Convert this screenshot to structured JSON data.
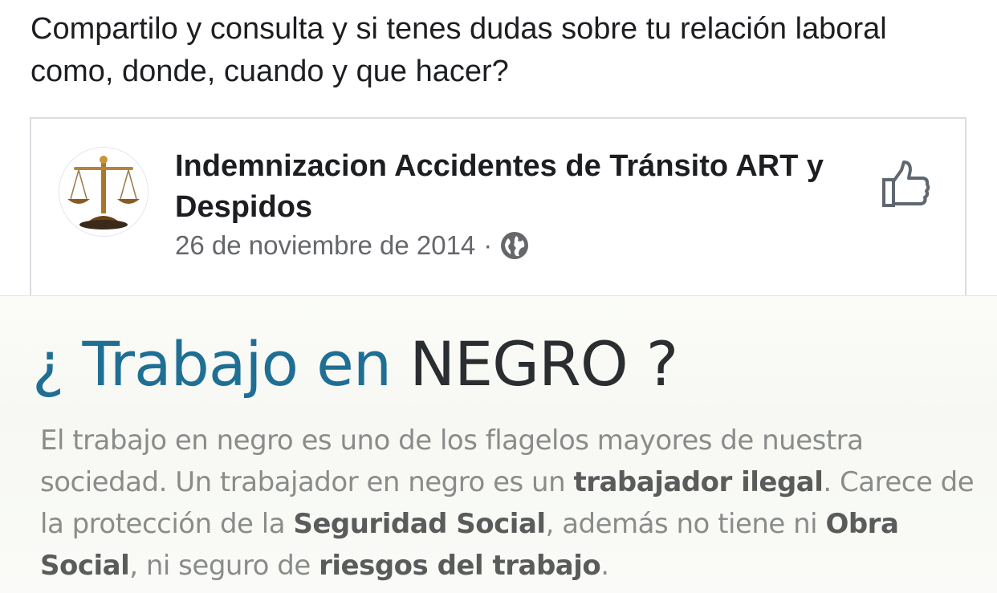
{
  "post": {
    "text": "Compartilo y consulta y si tenes dudas sobre tu relación laboral como, donde, cuando  y que hacer?"
  },
  "shared": {
    "page_name": "Indemnizacion Accidentes de Tránsito ART y Despidos",
    "date": "26 de noviembre de 2014",
    "separator": "·",
    "avatar_icon": "scales-of-justice-icon",
    "privacy_icon": "globe-icon",
    "like_icon": "thumbs-up-icon"
  },
  "image": {
    "headline_q_open": "¿",
    "headline_blue": "Trabajo en",
    "headline_dark": "NEGRO ?",
    "body": {
      "p1": "El trabajo en negro es uno de los flagelos mayores de nuestra sociedad. Un trabajador en negro es un ",
      "b1": "trabajador ilegal",
      "p2": ". Carece de la protección de la ",
      "b2": "Seguridad Social",
      "p3": ", además no tiene ni ",
      "b3": "Obra Social",
      "p4": ", ni seguro de ",
      "b4": "riesgos del trabajo",
      "p5": "."
    }
  },
  "colors": {
    "text_primary": "#1c1e21",
    "text_secondary": "#65676b",
    "headline_blue": "#1f6f95",
    "headline_dark": "#2a2e30"
  }
}
